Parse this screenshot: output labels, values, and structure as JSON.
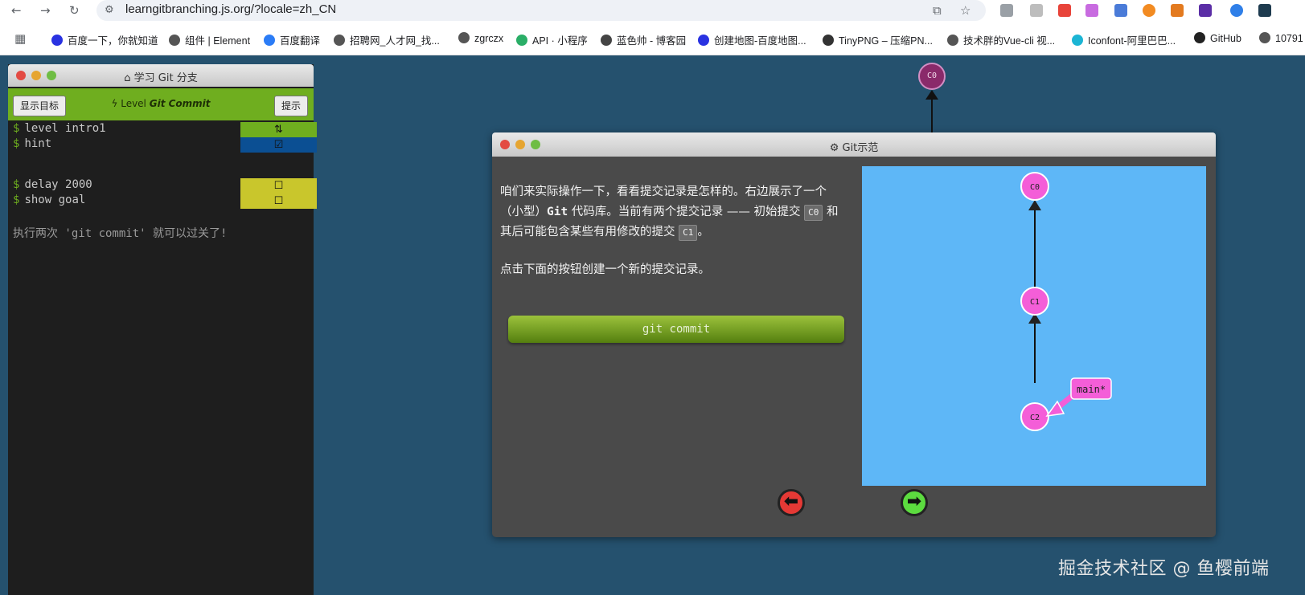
{
  "browser": {
    "url": "learngitbranching.js.org/?locale=zh_CN",
    "bookmarks": [
      {
        "label": "百度一下，你就知道",
        "icon": "baidu-icon",
        "color": "#2932e1"
      },
      {
        "label": "组件 | Element",
        "icon": "globe-icon",
        "color": "#555555"
      },
      {
        "label": "百度翻译",
        "icon": "translate-icon",
        "color": "#2b7cf6"
      },
      {
        "label": "招聘网_人才网_找...",
        "icon": "globe-icon",
        "color": "#555555"
      },
      {
        "label": "zgrczx",
        "icon": "globe-icon",
        "color": "#555555"
      },
      {
        "label": "API · 小程序",
        "icon": "wechat-icon",
        "color": "#2aae67"
      },
      {
        "label": "蓝色帅 - 博客园",
        "icon": "blog-icon",
        "color": "#444444"
      },
      {
        "label": "创建地图-百度地图...",
        "icon": "baidu-map-icon",
        "color": "#2932e1"
      },
      {
        "label": "TinyPNG – 压缩PN...",
        "icon": "panda-icon",
        "color": "#333333"
      },
      {
        "label": "技术胖的Vue-cli 视...",
        "icon": "globe-icon",
        "color": "#555555"
      },
      {
        "label": "Iconfont-阿里巴巴...",
        "icon": "iconfont-icon",
        "color": "#1cb5d4"
      },
      {
        "label": "GitHub",
        "icon": "github-icon",
        "color": "#222222"
      },
      {
        "label": "10791",
        "icon": "globe-icon",
        "color": "#555555"
      }
    ]
  },
  "sidebar": {
    "title": "学习 Git 分支",
    "show_goal_button": "显示目标",
    "hint_button": "提示",
    "level_prefix": "Level",
    "level_name": "Git Commit",
    "commands": [
      {
        "text": "level intro1",
        "box_color": "#6fae1f",
        "status": "refresh"
      },
      {
        "text": "hint",
        "box_color": "#0b4f93",
        "status": "checked"
      },
      {
        "text": "delay 2000",
        "box_color": "#c9c62c",
        "status": "unchecked"
      },
      {
        "text": "show goal",
        "box_color": "#c9c62c",
        "status": "unchecked"
      }
    ],
    "feedback": "执行两次 'git commit' 就可以过关了!"
  },
  "background_tree": {
    "node": "C0"
  },
  "modal": {
    "title": "Git示范",
    "paragraph1_a": "咱们来实际操作一下，看看提交记录是怎样的。右边展示了一个（小型）",
    "paragraph1_b": "Git",
    "paragraph1_c": " 代码库。当前有两个提交记录 —— 初始提交",
    "code_c0": "C0",
    "paragraph1_d": " 和其后可能包含某些有用修改的提交 ",
    "code_c1": "C1",
    "paragraph1_e": "。",
    "paragraph2": "点击下面的按钮创建一个新的提交记录。",
    "commit_button": "git commit",
    "graph": {
      "commits": [
        "C0",
        "C1",
        "C2"
      ],
      "branch": "main*",
      "node_color": "#f45ed8",
      "background": "#5eb7f7"
    },
    "prev_color": "#e53935",
    "next_color": "#5cdb3f"
  },
  "watermark": "掘金技术社区 @ 鱼樱前端"
}
